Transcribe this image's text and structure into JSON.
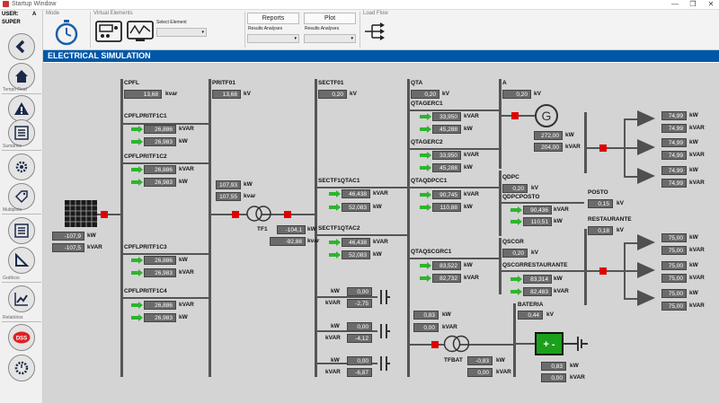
{
  "window": {
    "title": "Startup Window"
  },
  "user": {
    "label": "USER:",
    "initial": "A",
    "name": "SUPER"
  },
  "sidebar": {
    "sections": [
      "Tempo Real",
      "Sumários",
      "Multiplots",
      "Gráficos",
      "Relatórios"
    ]
  },
  "toolbar": {
    "mode_label": "Mode",
    "virtual_label": "Virtual Elements",
    "select_element_label": "Select Element",
    "reports_label": "Reports",
    "plot_label": "Plot",
    "results_label_1": "Results Analyses",
    "results_label_2": "Results Analyses",
    "loadflow_label": "Load Flow"
  },
  "banner": {
    "title": "ELECTRICAL SIMULATION"
  },
  "colors": {
    "banner": "#0057a8",
    "breaker": "#e00000",
    "arrow": "#2db52d"
  },
  "units": {
    "kw": "kW",
    "kvar": "kVAR",
    "kvar2": "kvar"
  },
  "diagram": {
    "grid": {
      "p": "-107,9",
      "q": "-107,5"
    },
    "cpfl": {
      "label": "CPFL",
      "val": "13,68"
    },
    "c1": {
      "label": "CPFLPRITF1C1",
      "p": "26,886",
      "q": "26,983"
    },
    "c2": {
      "label": "CPFLPRITF1C2",
      "p": "26,886",
      "q": "26,983"
    },
    "c3": {
      "label": "CPFLPRITF1C3",
      "p": "26,886",
      "q": "26,983"
    },
    "c4": {
      "label": "CPFLPRITF1C4",
      "p": "26,886",
      "q": "26,983"
    },
    "pritf01": {
      "label": "PRITF01",
      "val": "13,68",
      "p": "107,93",
      "q": "107,55"
    },
    "tf1": {
      "label": "TF1",
      "p": "-104,1",
      "q": "-92,88"
    },
    "sectf01": {
      "label": "SECTF01",
      "val": "0,20"
    },
    "q1": {
      "label": "SECTF1QTAC1",
      "p": "46,438",
      "q": "52,083"
    },
    "q2": {
      "label": "SECTF1QTAC2",
      "p": "46,438",
      "q": "52,083"
    },
    "cap1": {
      "p": "0,00",
      "q": "-2,75"
    },
    "cap2": {
      "p": "0,00",
      "q": "-4,12"
    },
    "cap3": {
      "p": "0,00",
      "q": "-6,87"
    },
    "qta": {
      "label": "QTA",
      "val": "0,20"
    },
    "qtagerc1": {
      "label": "QTAGERC1",
      "p": "33,950",
      "q": "45,288"
    },
    "qtagerc2": {
      "label": "QTAGERC2",
      "p": "33,950",
      "q": "45,288"
    },
    "qtaqdpcc1": {
      "label": "QTAQDPCC1",
      "p": "90,745",
      "q": "110,88"
    },
    "qtaqsc": {
      "label": "QTAQSCGRC1",
      "p": "83,522",
      "q": "82,732"
    },
    "bat_in": {
      "p": "0,83",
      "q": "0,00"
    },
    "tfbat": {
      "label": "TFBAT",
      "p": "-0,83",
      "q": "0,00"
    },
    "a": {
      "label": "A",
      "val": "0,20"
    },
    "gen": {
      "p": "272,00",
      "q": "204,00"
    },
    "qdpc": {
      "label": "QDPC",
      "val": "0,20"
    },
    "qdpcposto": {
      "label": "QDPCPOSTO",
      "p": "90,436",
      "q": "110,51"
    },
    "qscgr": {
      "label": "QSCGR",
      "val": "0,20"
    },
    "qscgrrest": {
      "label": "QSCGRRESTAURANTE",
      "p": "83,314",
      "q": "82,483"
    },
    "bateria": {
      "label": "BATERIA",
      "val": "0,44",
      "p": "0,83",
      "q": "0,00"
    },
    "posto": {
      "label": "POSTO",
      "val": "0,15",
      "loads": [
        "74,99",
        "74,99",
        "74,99",
        "74,99",
        "74,99",
        "74,99"
      ]
    },
    "restaurante": {
      "label": "RESTAURANTE",
      "val": "0,18",
      "loads": [
        "75,00",
        "75,00",
        "75,00",
        "75,00",
        "75,00",
        "75,00"
      ]
    }
  }
}
